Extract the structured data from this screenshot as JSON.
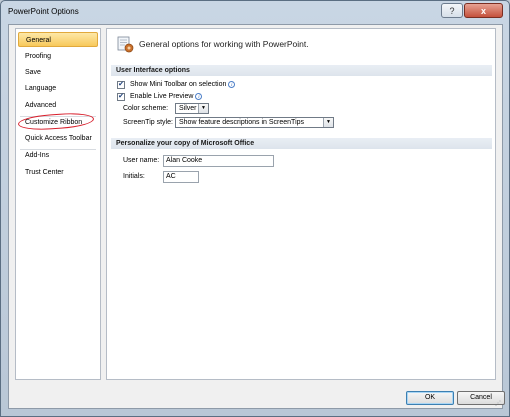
{
  "window": {
    "title": "PowerPoint Options",
    "help_glyph": "?",
    "close_glyph": "x"
  },
  "sidebar": {
    "items": [
      {
        "label": "General"
      },
      {
        "label": "Proofing"
      },
      {
        "label": "Save"
      },
      {
        "label": "Language"
      },
      {
        "label": "Advanced"
      },
      {
        "label": "Customize Ribbon"
      },
      {
        "label": "Quick Access Toolbar"
      },
      {
        "label": "Add-Ins"
      },
      {
        "label": "Trust Center"
      }
    ],
    "selected": "General"
  },
  "content": {
    "header": "General options for working with PowerPoint.",
    "ui_section": {
      "title": "User Interface options",
      "mini_toolbar": {
        "label": "Show Mini Toolbar on selection",
        "checked": true
      },
      "live_preview": {
        "label": "Enable Live Preview",
        "checked": true
      },
      "color_scheme": {
        "label": "Color scheme:",
        "value": "Silver"
      },
      "screentip": {
        "label": "ScreenTip style:",
        "value": "Show feature descriptions in ScreenTips"
      }
    },
    "personalize_section": {
      "title": "Personalize your copy of Microsoft Office",
      "username": {
        "label": "User name:",
        "value": "Alan Cooke"
      },
      "initials": {
        "label": "Initials:",
        "value": "AC"
      }
    }
  },
  "footer": {
    "ok": "OK",
    "cancel": "Cancel"
  },
  "colors": {
    "selected_nav": "#f8c95b",
    "annotation_circle": "#d81e2b",
    "close_button": "#c4513c"
  }
}
